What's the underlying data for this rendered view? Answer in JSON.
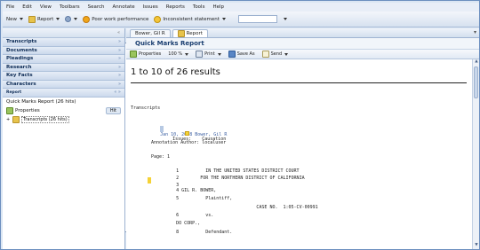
{
  "menu": [
    "File",
    "Edit",
    "View",
    "Toolbars",
    "Search",
    "Annotate",
    "Issues",
    "Reports",
    "Tools",
    "Help"
  ],
  "toolbar": {
    "new_label": "New",
    "report_label": "Report",
    "item1_label": "Poor work performance",
    "item2_label": "Inconsistent statement",
    "search_placeholder": ""
  },
  "left_panel": {
    "sections": [
      "Transcripts",
      "Documents",
      "Pleadings",
      "Research",
      "Key Facts",
      "Characters"
    ],
    "report_section": "Report",
    "report_item": "Quick Marks Report (26 hits)",
    "properties_label": "Properties",
    "properties_badge": "Hit",
    "tree_item": "Transcripts (26 hits)"
  },
  "main": {
    "tabs": [
      "Bower, Gil R",
      "Report"
    ],
    "report_title": "Quick Marks Report",
    "report_toolbar": {
      "properties": "Properties",
      "zoom": "100 %",
      "print": "Print",
      "save_as": "Save As",
      "send": "Send"
    },
    "results_text": "1 to 10 of 26 results",
    "section_label": "Transcripts",
    "entry_date": "Jan 10, 2008 Bower, Gil R",
    "issues_line": "Issues:    Causation",
    "annotation_line": "Annotation Author: localuser",
    "page_line": "Page: 1",
    "lines": [
      {
        "num": "1",
        "text": "          IN THE UNITED STATES DISTRICT COURT"
      },
      {
        "num": "2",
        "text": "        FOR THE NORTHERN DISTRICT OF CALIFORNIA"
      },
      {
        "num": "3",
        "text": ""
      },
      {
        "num": "4",
        "text": "GIL R. BOWER,"
      },
      {
        "num": "5",
        "text": "          Plaintiff,"
      },
      {
        "num": "",
        "text": "                              CASE NO.  1:05-CV-00991"
      },
      {
        "num": "6",
        "text": "          vs."
      },
      {
        "num": "",
        "text": "DO CORP.,"
      },
      {
        "num": "8",
        "text": "          Defendant."
      }
    ]
  },
  "colors": {
    "accent": "#1a3e70",
    "highlight": "#f5d236",
    "link": "#3a5ea1"
  }
}
